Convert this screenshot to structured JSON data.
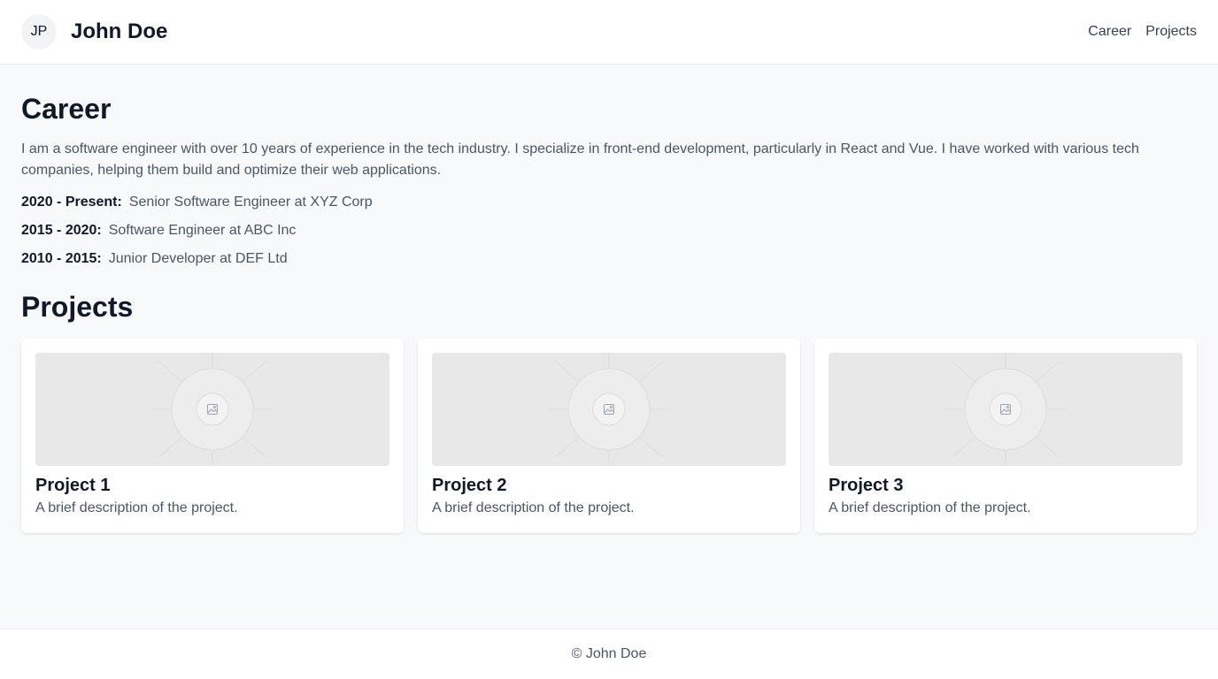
{
  "header": {
    "avatar_initials": "JP",
    "title": "John Doe",
    "nav": [
      {
        "label": "Career"
      },
      {
        "label": "Projects"
      }
    ]
  },
  "career": {
    "title": "Career",
    "intro": "I am a software engineer with over 10 years of experience in the tech industry. I specialize in front-end development, particularly in React and Vue. I have worked with various tech companies, helping them build and optimize their web applications.",
    "items": [
      {
        "period": "2020 - Present:",
        "role": "Senior Software Engineer at XYZ Corp"
      },
      {
        "period": "2015 - 2020:",
        "role": "Software Engineer at ABC Inc"
      },
      {
        "period": "2010 - 2015:",
        "role": "Junior Developer at DEF Ltd"
      }
    ]
  },
  "projects": {
    "title": "Projects",
    "items": [
      {
        "name": "Project 1",
        "description": "A brief description of the project.",
        "image_icon": "image-placeholder-icon"
      },
      {
        "name": "Project 2",
        "description": "A brief description of the project.",
        "image_icon": "image-placeholder-icon"
      },
      {
        "name": "Project 3",
        "description": "A brief description of the project.",
        "image_icon": "image-placeholder-icon"
      }
    ]
  },
  "footer": {
    "text": "© John Doe"
  },
  "colors": {
    "page_background": "#f8f9fb",
    "surface": "#ffffff",
    "text_primary": "#111827",
    "text_secondary": "#4b5563",
    "border": "#e5e7eb",
    "image_placeholder": "#e8e8e8"
  }
}
